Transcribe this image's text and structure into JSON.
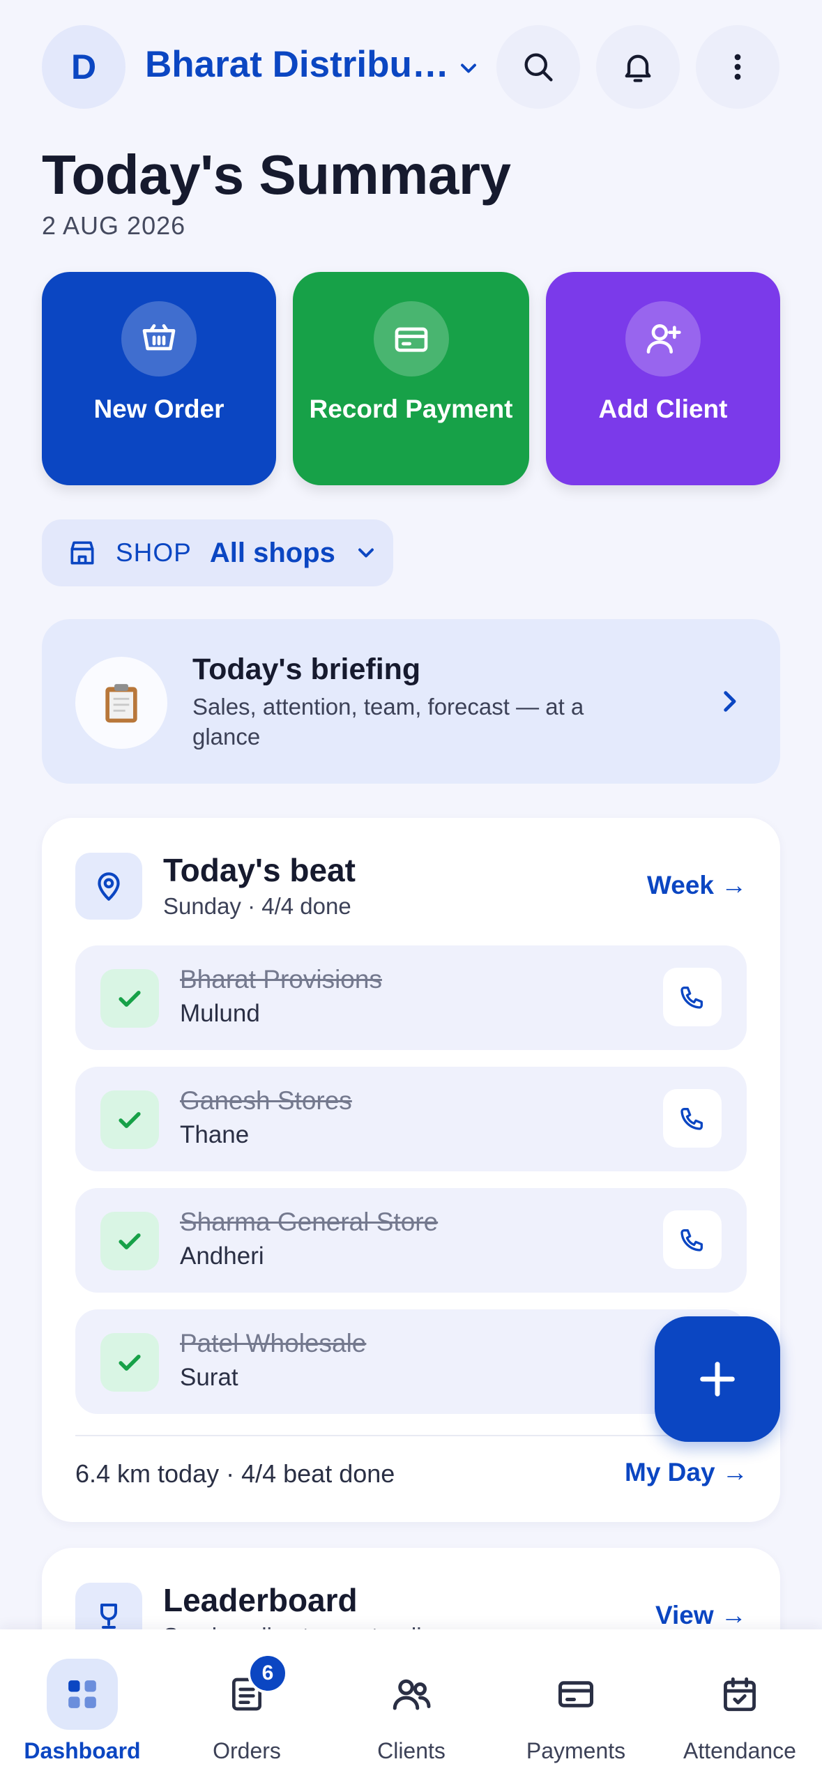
{
  "header": {
    "avatar_letter": "D",
    "org_name": "Bharat Distribu…",
    "title": "Today's Summary",
    "date": "2 AUG 2026"
  },
  "actions": [
    {
      "label": "New Order",
      "color": "#0b46c2",
      "icon": "basket-icon"
    },
    {
      "label": "Record Payment",
      "color": "#17a148",
      "icon": "card-icon"
    },
    {
      "label": "Add Client",
      "color": "#7b3aea",
      "icon": "add-user-icon"
    }
  ],
  "shop_filter": {
    "key": "SHOP",
    "value": "All shops"
  },
  "briefing": {
    "title": "Today's briefing",
    "subtitle": "Sales, attention, team, forecast — at a glance",
    "icon": "clipboard-icon"
  },
  "beat": {
    "title": "Today's beat",
    "subtitle": "Sunday · 4/4 done",
    "link": "Week →",
    "items": [
      {
        "name": "Bharat Provisions",
        "area": "Mulund",
        "done": true
      },
      {
        "name": "Ganesh Stores",
        "area": "Thane",
        "done": true
      },
      {
        "name": "Sharma General Store",
        "area": "Andheri",
        "done": true
      },
      {
        "name": "Patel Wholesale",
        "area": "Surat",
        "done": true
      }
    ],
    "footer": "6.4 km today · 4/4 beat done",
    "footer_link": "My Day →"
  },
  "leaderboard": {
    "title": "Leaderboard",
    "subtitle": "Sunday · live team standings",
    "link": "View →"
  },
  "nav": [
    {
      "label": "Dashboard",
      "icon": "grid-icon",
      "active": true
    },
    {
      "label": "Orders",
      "icon": "orders-icon",
      "badge": "6"
    },
    {
      "label": "Clients",
      "icon": "users-icon"
    },
    {
      "label": "Payments",
      "icon": "card-icon"
    },
    {
      "label": "Attendance",
      "icon": "calendar-check-icon"
    }
  ]
}
